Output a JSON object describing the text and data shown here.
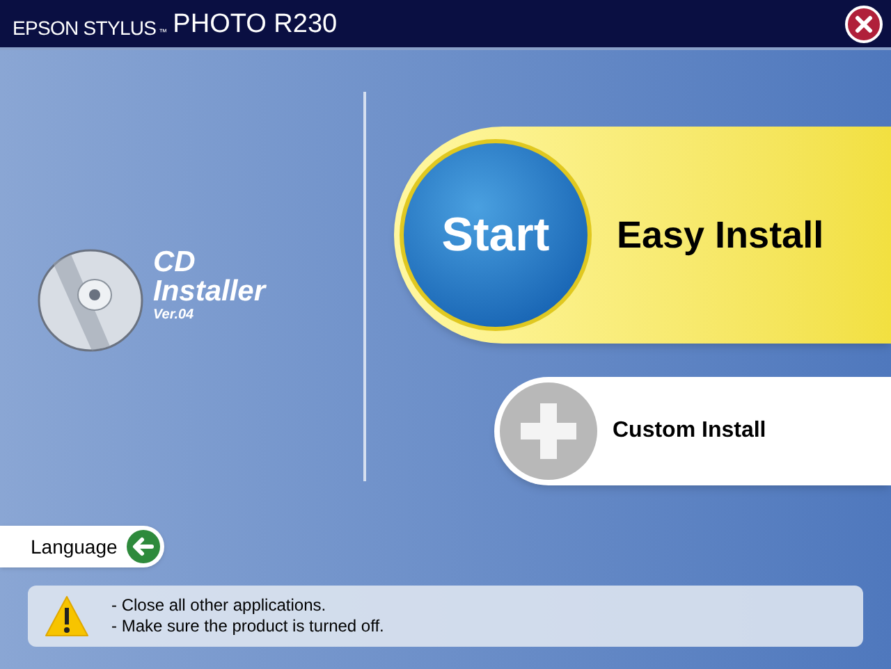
{
  "window": {
    "title_brand": "EPSON STYLUS",
    "title_mark": "™",
    "title_model": "PHOTO R230"
  },
  "product": {
    "line_1": "CD",
    "line_2": "Installer",
    "version": "Ver.04"
  },
  "buttons": [
    {
      "kind": "primary",
      "badge": "Start",
      "label": "Easy Install"
    },
    {
      "kind": "secondary",
      "label": "Custom Install"
    }
  ],
  "language_button": {
    "label": "Language"
  },
  "notice": {
    "lines": [
      "- Close all other applications.",
      "- Make sure the product is turned off."
    ]
  }
}
